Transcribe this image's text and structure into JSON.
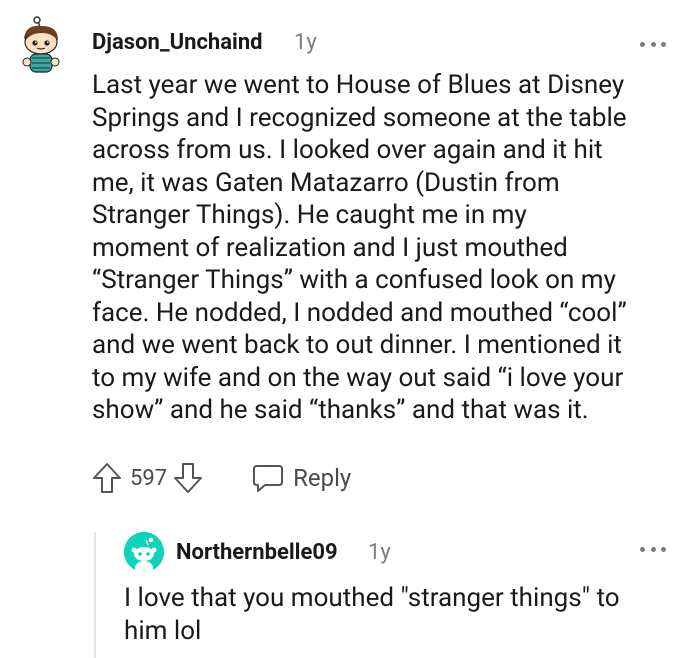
{
  "comment": {
    "username": "Djason_Unchaind",
    "age": "1y",
    "body_lines": [
      "Last year we went to House of Blues at Disney",
      "Springs and I recognized someone at the table",
      "across from us. I looked over again and it hit",
      "me, it was Gaten Matazarro (Dustin from",
      "Stranger Things). He caught me in my",
      "moment of realization and I just mouthed",
      "“Stranger Things” with a confused look on my",
      "face. He nodded, I nodded and mouthed “cool”",
      "and we went back to out dinner. I mentioned it",
      "to my wife and on the way out said “i love your",
      "show” and he said “thanks” and that was it."
    ],
    "score": "597",
    "reply_label": "Reply",
    "icons": {
      "avatar": "snoo-avatar",
      "more": "more-options-icon",
      "upvote": "upvote-arrow-icon",
      "downvote": "downvote-arrow-icon",
      "reply": "reply-bubble-icon"
    }
  },
  "reply": {
    "username": "Northernbelle09",
    "age": "1y",
    "body_lines": [
      "I love that you mouthed \"stranger things\" to",
      "him lol"
    ],
    "avatar_color": "#0dd3bb"
  }
}
